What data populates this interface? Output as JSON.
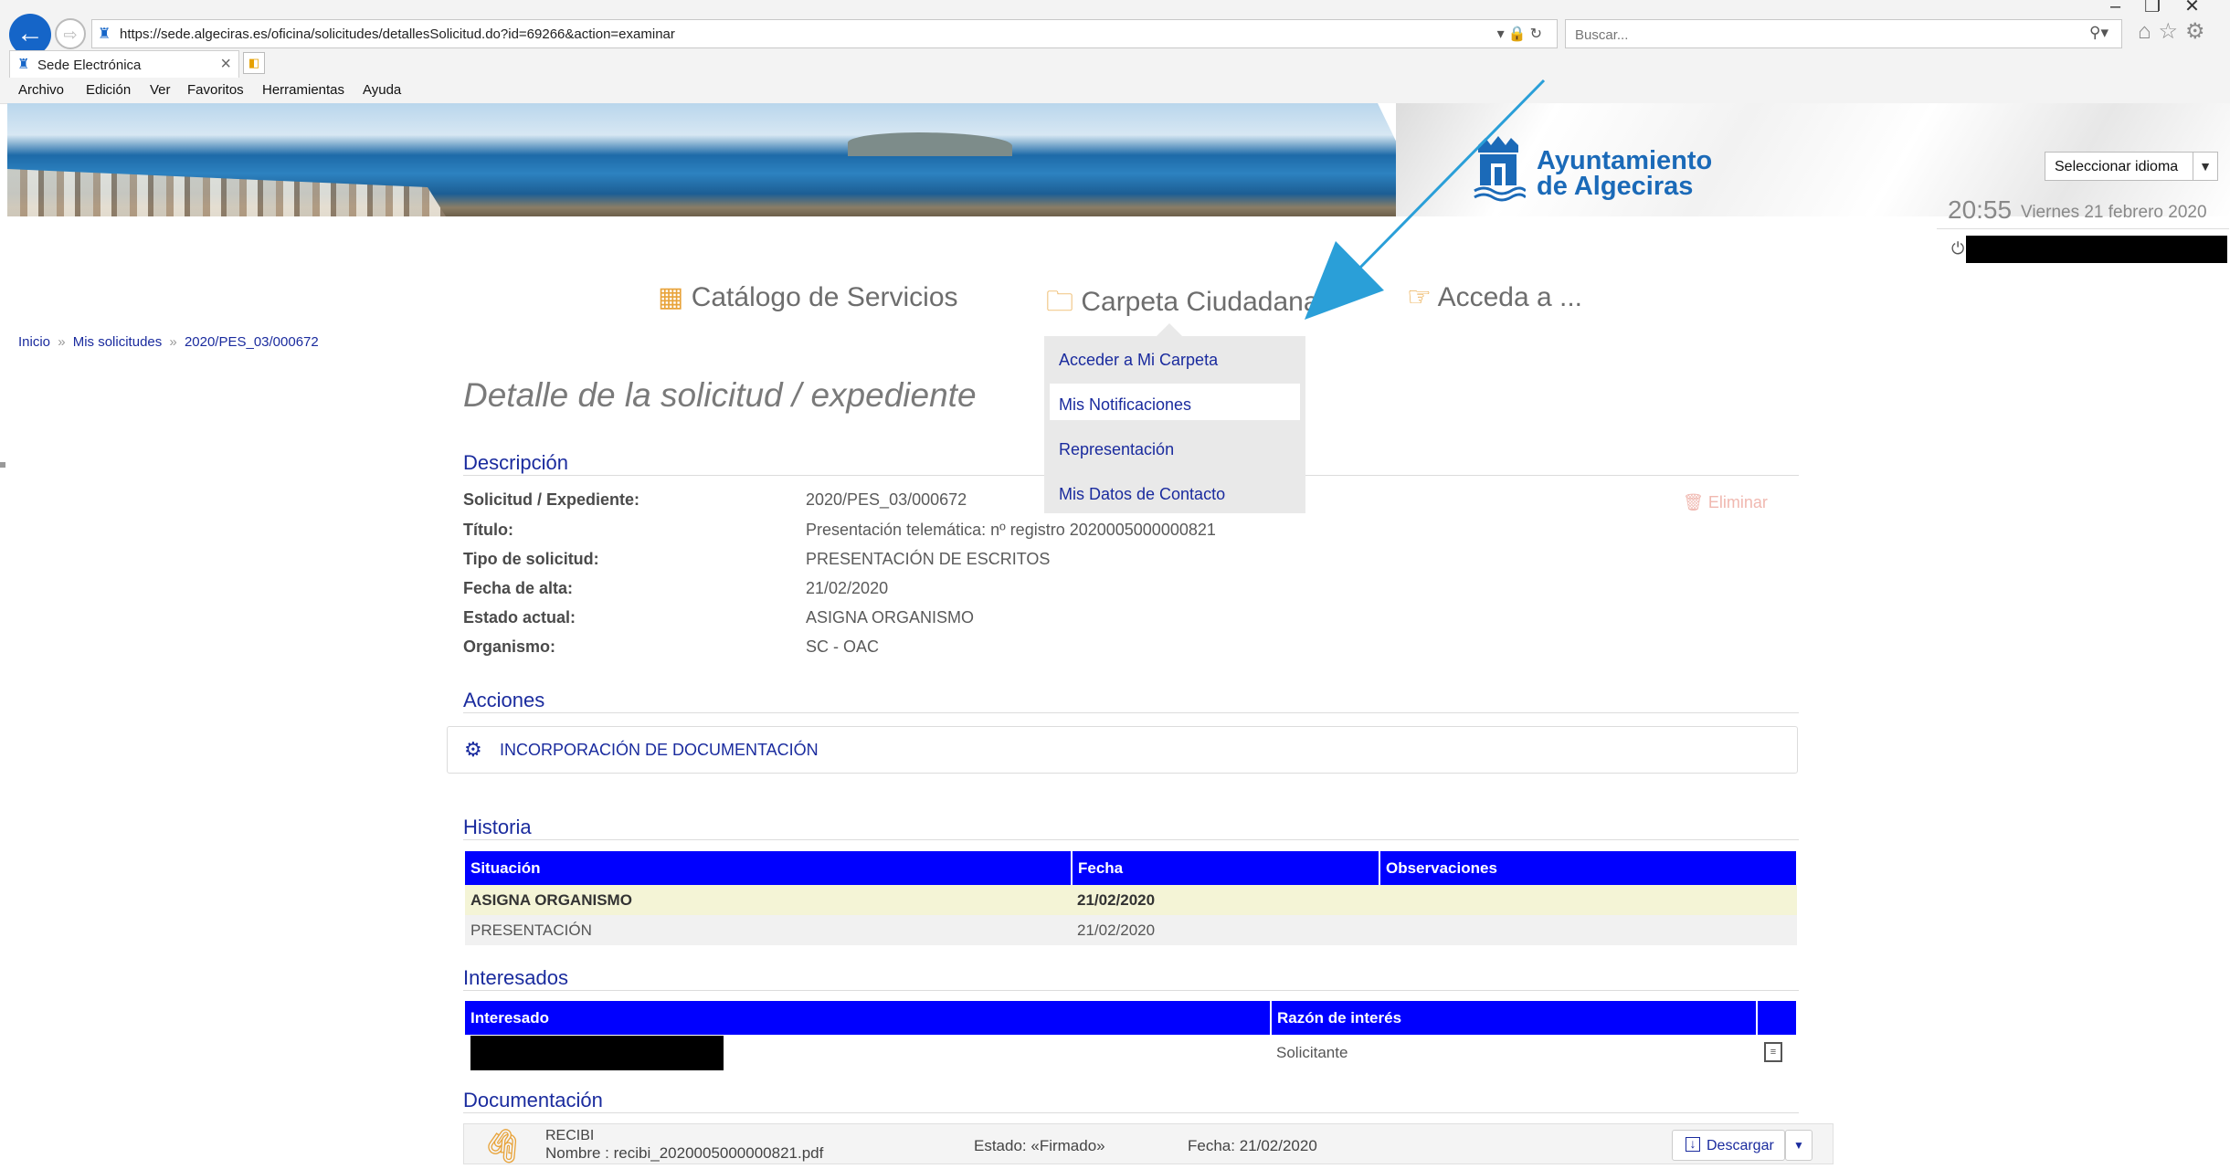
{
  "browser": {
    "url": "https://sede.algeciras.es/oficina/solicitudes/detallesSolicitud.do?id=69266&action=examinar",
    "search_placeholder": "Buscar...",
    "tab_title": "Sede Electrónica",
    "menu": [
      "Archivo",
      "Edición",
      "Ver",
      "Favoritos",
      "Herramientas",
      "Ayuda"
    ]
  },
  "header": {
    "logo_line1": "Ayuntamiento",
    "logo_line2": "de Algeciras",
    "language_select": "Seleccionar idioma",
    "time": "20:55",
    "date": "Viernes 21 febrero 2020"
  },
  "nav": {
    "catalogo": "Catálogo de Servicios",
    "carpeta": "Carpeta Ciudadana",
    "acceda": "Acceda a ..."
  },
  "dropdown": {
    "items": [
      "Acceder a Mi Carpeta",
      "Mis Notificaciones",
      "Representación",
      "Mis Datos de Contacto"
    ]
  },
  "breadcrumb": {
    "inicio": "Inicio",
    "mis_solicitudes": "Mis solicitudes",
    "current": "2020/PES_03/000672",
    "sep": "»"
  },
  "page": {
    "title": "Detalle de la solicitud / expediente",
    "delete": "Eliminar"
  },
  "descripcion": {
    "title": "Descripción",
    "rows": [
      {
        "label": "Solicitud / Expediente:",
        "value": "2020/PES_03/000672"
      },
      {
        "label": "Título:",
        "value": "Presentación telemática: nº registro 2020005000000821"
      },
      {
        "label": "Tipo de solicitud:",
        "value": "PRESENTACIÓN DE ESCRITOS"
      },
      {
        "label": "Fecha de alta:",
        "value": "21/02/2020"
      },
      {
        "label": "Estado actual:",
        "value": "ASIGNA ORGANISMO"
      },
      {
        "label": "Organismo:",
        "value": "SC - OAC"
      }
    ]
  },
  "acciones": {
    "title": "Acciones",
    "action_label": "INCORPORACIÓN DE DOCUMENTACIÓN"
  },
  "historia": {
    "title": "Historia",
    "headers": [
      "Situación",
      "Fecha",
      "Observaciones"
    ],
    "rows": [
      {
        "situacion": "ASIGNA ORGANISMO",
        "fecha": "21/02/2020",
        "observaciones": ""
      },
      {
        "situacion": "PRESENTACIÓN",
        "fecha": "21/02/2020",
        "observaciones": ""
      }
    ]
  },
  "interesados": {
    "title": "Interesados",
    "headers": [
      "Interesado",
      "Razón de interés",
      ""
    ],
    "rows": [
      {
        "interesado": "",
        "razon": "Solicitante"
      }
    ]
  },
  "documentacion": {
    "title": "Documentación",
    "doc_name": "RECIBI",
    "doc_file": "Nombre : recibi_2020005000000821.pdf",
    "estado": "Estado: «Firmado»",
    "fecha": "Fecha: 21/02/2020",
    "download": "Descargar"
  },
  "colors": {
    "link": "#1a2b9e",
    "table_header": "#0000ff",
    "accent_orange": "#e8a33a",
    "logo_blue": "#1b6ab8",
    "annotation_arrow": "#2a9fd8"
  }
}
